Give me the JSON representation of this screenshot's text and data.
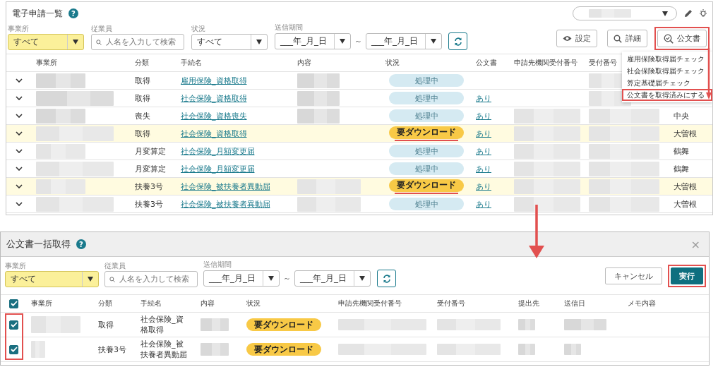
{
  "main": {
    "title": "電子申請一覧",
    "help": "?",
    "filters": [
      {
        "kind": "select",
        "label": "事業所",
        "value": "すべて",
        "active": true
      },
      {
        "kind": "search",
        "label": "従業員",
        "placeholder": "人名を入力して検索"
      },
      {
        "kind": "select",
        "label": "状況",
        "value": "すべて",
        "active": false
      },
      {
        "kind": "daterange",
        "label": "送信期間",
        "from": "___年_月_日",
        "separator": "～",
        "to": "___年_月_日"
      }
    ],
    "toolbar": [
      {
        "label": "設定",
        "annotated": false
      },
      {
        "label": "詳細",
        "annotated": false
      },
      {
        "label": "公文書",
        "annotated": true
      }
    ],
    "menu": [
      {
        "label": "雇用保険取得届チェック",
        "annotated": false
      },
      {
        "label": "社会保険取得届チェック",
        "annotated": false
      },
      {
        "label": "算定基礎届チェック",
        "annotated": false
      },
      {
        "label": "公文書を取得済みにする",
        "annotated": true
      }
    ],
    "columns": [
      "事業所",
      "分類",
      "手続名",
      "内容",
      "状況",
      "公文書",
      "申請先機関受付番号",
      "受付番号"
    ],
    "rows": [
      {
        "category": "取得",
        "procedure": "雇用保険_資格取得",
        "status": {
          "kind": "processing",
          "label": "処理中",
          "annotated": false
        },
        "highlighted": false
      },
      {
        "category": "取得",
        "procedure": "社会保険_資格取得",
        "status": {
          "kind": "processing",
          "label": "処理中",
          "annotated": false
        },
        "document": "あり",
        "highlighted": false
      },
      {
        "category": "喪失",
        "procedure": "社会保険_資格喪失",
        "status": {
          "kind": "processing",
          "label": "処理中",
          "annotated": false
        },
        "document": "あり",
        "column_10": "中央",
        "highlighted": false
      },
      {
        "category": "取得",
        "procedure": "社会保険_資格取得",
        "status": {
          "kind": "download",
          "label": "要ダウンロード",
          "annotated": true
        },
        "document": "あり",
        "column_10": "大曽根",
        "highlighted": true
      },
      {
        "category": "月変算定",
        "procedure": "社会保険_月額変更届",
        "status": {
          "kind": "processing",
          "label": "処理中",
          "annotated": false
        },
        "document": "あり",
        "column_10": "鶴舞",
        "highlighted": false
      },
      {
        "category": "月変算定",
        "procedure": "社会保険_月額変更届",
        "status": {
          "kind": "processing",
          "label": "処理中",
          "annotated": false
        },
        "document": "あり",
        "column_10": "鶴舞",
        "highlighted": false
      },
      {
        "category": "扶養3号",
        "procedure": "社会保険_被扶養者異動届",
        "status": {
          "kind": "download",
          "label": "要ダウンロード",
          "annotated": true
        },
        "document": "あり",
        "column_10": "大曽根",
        "highlighted": true
      },
      {
        "category": "扶養3号",
        "procedure": "社会保険_被扶養者異動届",
        "status": {
          "kind": "processing",
          "label": "処理中",
          "annotated": false
        },
        "document": "あり",
        "column_10": "大曽根",
        "highlighted": false
      }
    ]
  },
  "dialog": {
    "title": "公文書一括取得",
    "help": "?",
    "close": "×",
    "filters": [
      {
        "kind": "select",
        "label": "事業所",
        "value": "すべて",
        "active": true
      },
      {
        "kind": "search",
        "label": "従業員",
        "placeholder": "人名を入力して検索"
      },
      {
        "kind": "daterange",
        "label": "送信期間",
        "from": "___年_月_日",
        "separator": "～",
        "to": "___年_月_日"
      }
    ],
    "buttons": [
      {
        "kind": "secondary",
        "label": "キャンセル",
        "annotated": false
      },
      {
        "kind": "primary",
        "label": "実行",
        "annotated": true
      }
    ],
    "select_all": {
      "checked": true
    },
    "checkboxes_annotated": true,
    "columns": [
      "事業所",
      "分類",
      "手続名",
      "内容",
      "状況",
      "申請先機関受付番号",
      "受付番号",
      "提出先",
      "送信日",
      "メモ内容"
    ],
    "rows": [
      {
        "checked": true,
        "category": "取得",
        "procedure": "社会保険_資格取得",
        "status": {
          "kind": "download",
          "label": "要ダウンロード"
        }
      },
      {
        "checked": true,
        "category": "扶養3号",
        "procedure": "社会保険_被扶養者異動届",
        "status": {
          "kind": "download",
          "label": "要ダウンロード"
        }
      }
    ]
  }
}
